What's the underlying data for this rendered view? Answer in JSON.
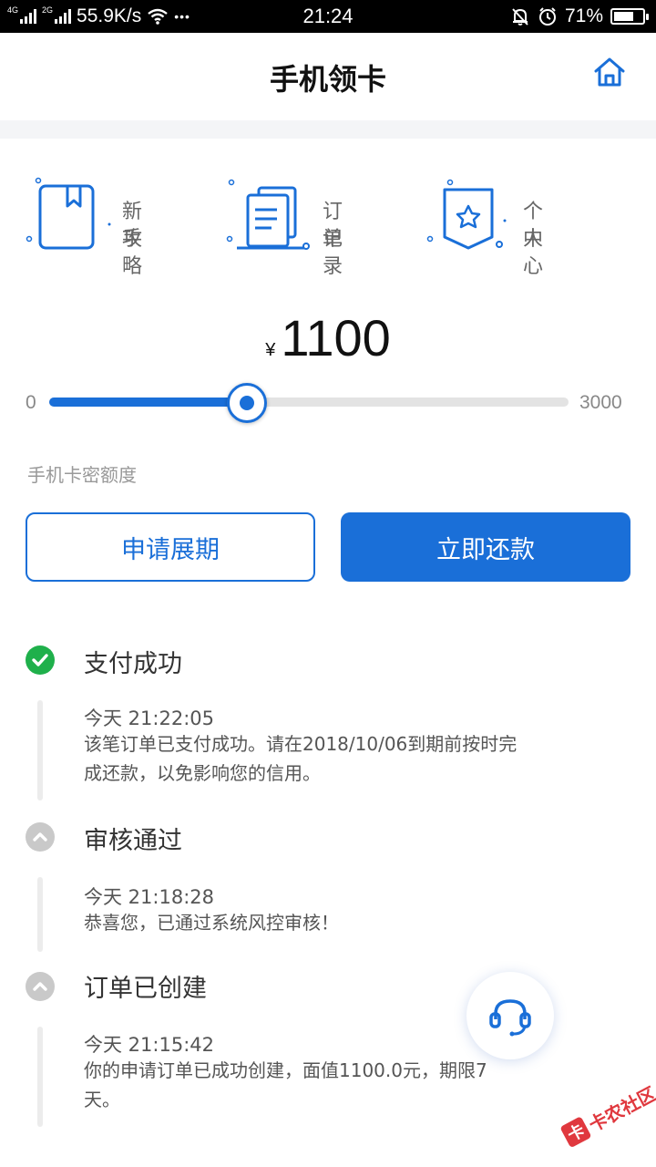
{
  "status_bar": {
    "net_1": "4G",
    "net_2": "2G",
    "speed": "55.9K/s",
    "more": "•••",
    "time": "21:24",
    "battery_text": "71%",
    "battery_level": 0.71
  },
  "header": {
    "title": "手机领卡",
    "home_icon": "home-icon"
  },
  "quick_links": [
    {
      "line1": "新 手",
      "line2": "攻 略",
      "icon": "book-bookmark-icon"
    },
    {
      "line1": "订 单",
      "line2": "记 录",
      "icon": "documents-icon"
    },
    {
      "line1": "个 人",
      "line2": "中 心",
      "icon": "star-badge-icon"
    }
  ],
  "amount": {
    "currency": "¥",
    "value": "1100"
  },
  "slider": {
    "min": "0",
    "max": "3000",
    "value": 1100
  },
  "limit_label": "手机卡密额度",
  "buttons": {
    "extend": "申请展期",
    "repay": "立即还款"
  },
  "timeline": [
    {
      "status": "success",
      "title": "支付成功",
      "time": "今天 21:22:05",
      "desc": "该笔订单已支付成功。请在2018/10/06到期前按时完成还款，以免影响您的信用。"
    },
    {
      "status": "done",
      "title": "审核通过",
      "time": "今天 21:18:28",
      "desc": "恭喜您，已通过系统风控审核！"
    },
    {
      "status": "done",
      "title": "订单已创建",
      "time": "今天 21:15:42",
      "desc": "你的申请订单已成功创建，面值1100.0元，期限7天。"
    }
  ],
  "support_icon": "headset-icon",
  "watermark": {
    "logo": "卡",
    "text": "卡农社区"
  },
  "colors": {
    "primary": "#1a6fd8",
    "success": "#1fb04b",
    "muted": "#c9c9c9"
  }
}
